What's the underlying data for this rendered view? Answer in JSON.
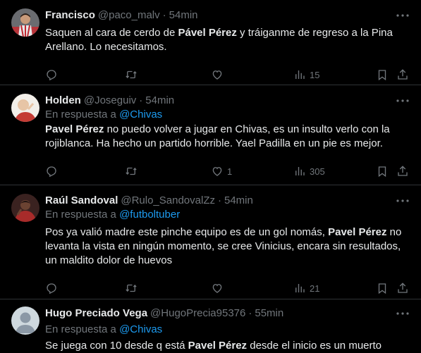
{
  "tweets": [
    {
      "name": "Francisco",
      "handle": "@paco_malv",
      "time": "54min",
      "reply_prefix": "",
      "reply_mention": "",
      "body_parts": [
        "Saquen al cara de cerdo de ",
        "Pável Pérez",
        " y tráiganme de regreso a la Pina Arellano. Lo necesitamos."
      ],
      "replies": "",
      "retweets": "",
      "likes": "",
      "views": "15"
    },
    {
      "name": "Holden",
      "handle": "@Joseguiv",
      "time": "54min",
      "reply_prefix": "En respuesta a ",
      "reply_mention": "@Chivas",
      "body_parts": [
        "",
        "Pavel Pérez",
        " no puedo volver a jugar en Chivas, es un insulto verlo con la rojiblanca. Ha hecho un partido horrible. Yael Padilla en un pie es mejor."
      ],
      "replies": "",
      "retweets": "",
      "likes": "1",
      "views": "305"
    },
    {
      "name": "Raúl Sandoval",
      "handle": "@Rulo_SandovalZz",
      "time": "54min",
      "reply_prefix": "En respuesta a ",
      "reply_mention": "@futboltuber",
      "body_parts": [
        "Pos ya valió madre este pinche equipo es de un gol nomás, ",
        "Pavel Pérez",
        " no levanta la vista en ningún momento, se cree Vinicius, encara sin resultados, un maldito dolor de huevos"
      ],
      "replies": "",
      "retweets": "",
      "likes": "",
      "views": "21"
    },
    {
      "name": "Hugo Preciado Vega",
      "handle": "@HugoPrecia95376",
      "time": "55min",
      "reply_prefix": "En respuesta a ",
      "reply_mention": "@Chivas",
      "body_parts": [
        "Se juega con 10 desde q está ",
        "Pavel Pérez",
        " desde el inicio es un muerto"
      ],
      "replies": "",
      "retweets": "",
      "likes": "",
      "views": ""
    }
  ]
}
